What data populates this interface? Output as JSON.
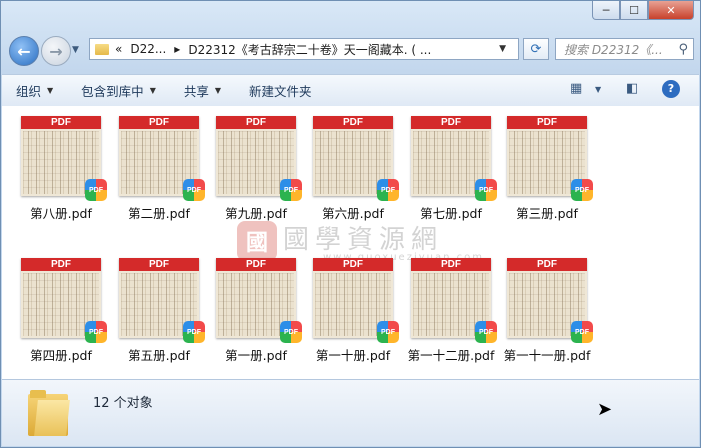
{
  "window": {
    "minimize": "─",
    "maximize": "☐",
    "close": "✕"
  },
  "nav": {
    "back_icon": "←",
    "forward_icon": "→",
    "dropdown": "▼"
  },
  "address": {
    "chevron": "«",
    "crumbs": [
      "D22...",
      "D22312《考古辞宗二十卷》天一阁藏本. ( ..."
    ],
    "sep": "▸",
    "dropdown": "▼"
  },
  "refresh_icon": "⟳",
  "search": {
    "placeholder": "搜索 D22312《...",
    "icon": "⚲"
  },
  "toolbar": {
    "organize": "组织",
    "include": "包含到库中",
    "share": "共享",
    "new_folder": "新建文件夹",
    "arrow": "▼"
  },
  "files": [
    {
      "name": "第八册.pdf"
    },
    {
      "name": "第二册.pdf"
    },
    {
      "name": "第九册.pdf"
    },
    {
      "name": "第六册.pdf"
    },
    {
      "name": "第七册.pdf"
    },
    {
      "name": "第三册.pdf"
    },
    {
      "name": "第四册.pdf"
    },
    {
      "name": "第五册.pdf"
    },
    {
      "name": "第一册.pdf"
    },
    {
      "name": "第一十册.pdf"
    },
    {
      "name": "第一十二册.pdf"
    },
    {
      "name": "第一十一册.pdf"
    }
  ],
  "thumb_band": "PDF",
  "badge_text": "PDF",
  "watermark": {
    "seal": "國",
    "title": "國學資源網",
    "url": "www.guoxueziyuan.com"
  },
  "status": {
    "count": "12 个对象"
  }
}
